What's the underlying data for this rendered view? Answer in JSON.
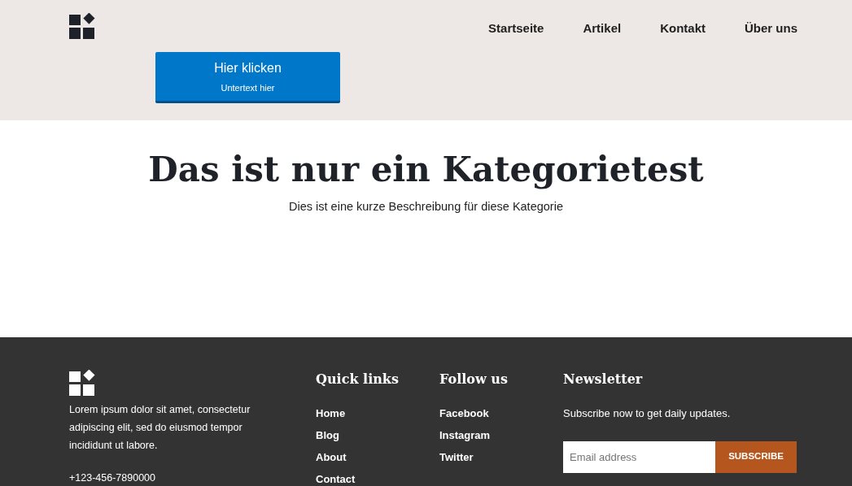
{
  "header": {
    "nav": [
      {
        "label": "Startseite"
      },
      {
        "label": "Artikel"
      },
      {
        "label": "Kontakt"
      },
      {
        "label": "Über uns"
      }
    ],
    "cta": {
      "label": "Hier klicken",
      "sublabel": "Untertext hier"
    }
  },
  "hero": {
    "title": "Das ist nur ein Kategorietest",
    "description": "Dies ist eine kurze Beschreibung für diese Kategorie"
  },
  "footer": {
    "about": "Lorem ipsum dolor sit amet, consectetur adipiscing elit, sed do eiusmod tempor incididunt ut labore.",
    "phone": "+123-456-7890000",
    "columns": [
      {
        "title": "Quick links",
        "links": [
          "Home",
          "Blog",
          "About",
          "Contact"
        ]
      },
      {
        "title": "Follow us",
        "links": [
          "Facebook",
          "Instagram",
          "Twitter"
        ]
      }
    ],
    "newsletter": {
      "title": "Newsletter",
      "text": "Subscribe now to get daily updates.",
      "placeholder": "Email address",
      "button": "SUBSCRIBE"
    }
  }
}
